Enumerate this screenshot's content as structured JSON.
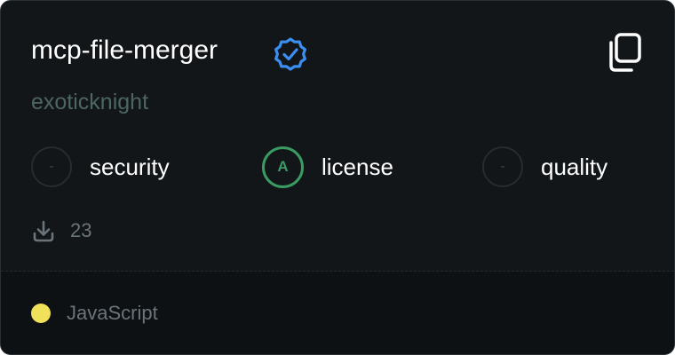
{
  "package": {
    "name": "mcp-file-merger",
    "author": "exoticknight",
    "downloads": "23",
    "language": "JavaScript"
  },
  "metrics": [
    {
      "grade": "-",
      "label": "security"
    },
    {
      "grade": "A",
      "label": "license"
    },
    {
      "grade": "-",
      "label": "quality"
    }
  ],
  "icons": {
    "verified": "verified-badge-icon",
    "copy": "copy-icon",
    "download": "download-icon"
  },
  "colors": {
    "card_bg": "#121619",
    "verified_blue": "#3b8ff0",
    "grade_a_green": "#3a9b63",
    "language_dot": "#f1e05a",
    "author_text": "#4e6660"
  }
}
